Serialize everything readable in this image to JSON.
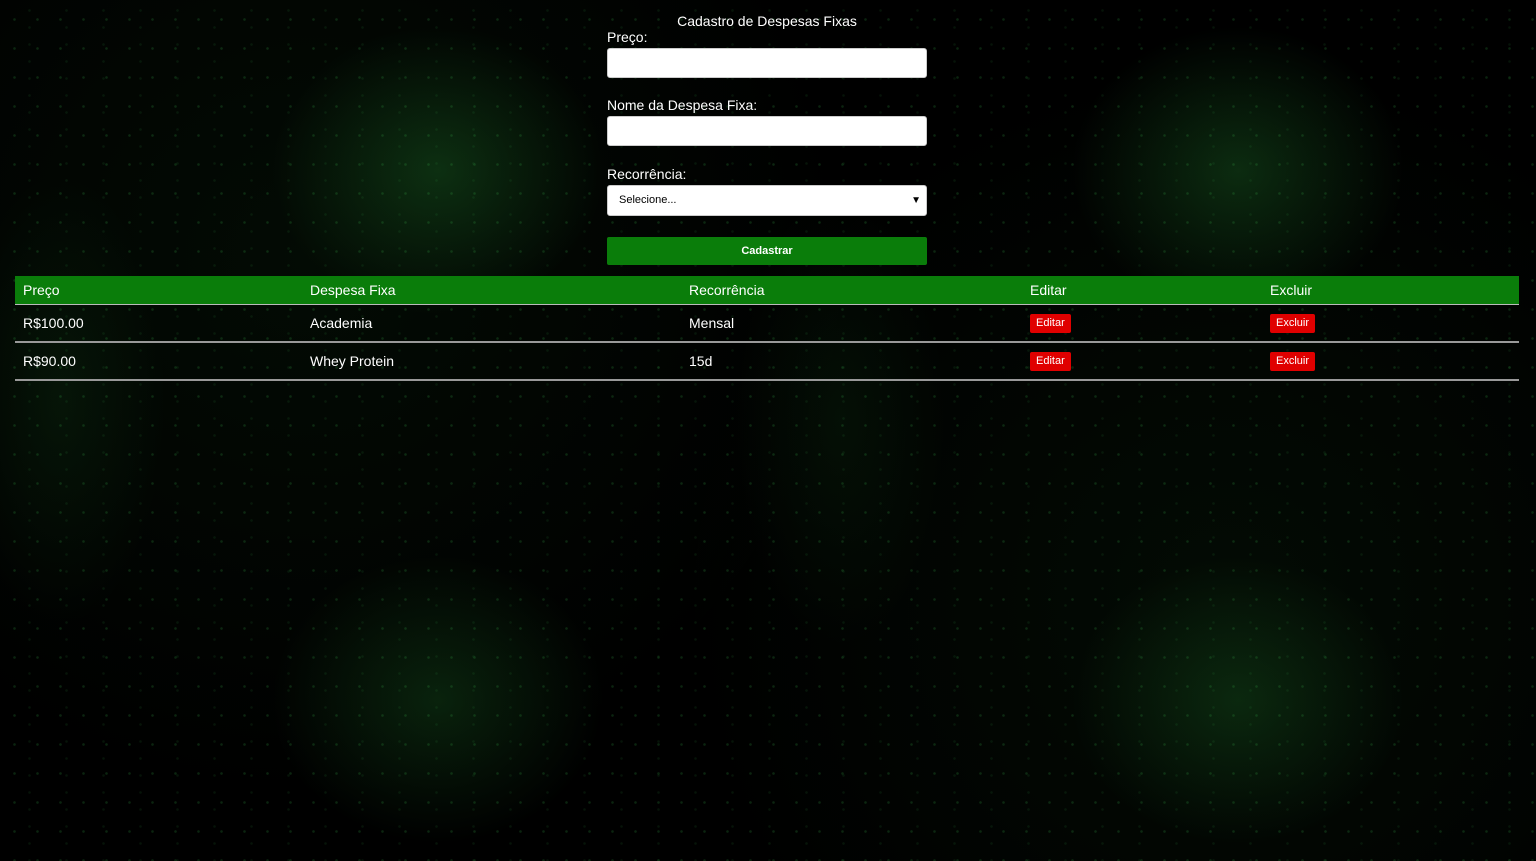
{
  "form": {
    "title": "Cadastro de Despesas Fixas",
    "price_label": "Preço:",
    "price_value": "",
    "name_label": "Nome da Despesa Fixa:",
    "name_value": "",
    "recurrence_label": "Recorrência:",
    "recurrence_selected": "Selecione...",
    "submit_label": "Cadastrar"
  },
  "table": {
    "headers": [
      "Preço",
      "Despesa Fixa",
      "Recorrência",
      "Editar",
      "Excluir"
    ],
    "rows": [
      {
        "price": "R$100.00",
        "name": "Academia",
        "recurrence": "Mensal",
        "edit_label": "Editar",
        "delete_label": "Excluir"
      },
      {
        "price": "R$90.00",
        "name": "Whey Protein",
        "recurrence": "15d",
        "edit_label": "Editar",
        "delete_label": "Excluir"
      }
    ]
  },
  "colors": {
    "background": "#000000",
    "accent_green": "#0a7d0a",
    "danger_red": "#e00000",
    "text": "#ffffff"
  },
  "icons": {
    "select_chevron": "chevron-down-icon"
  }
}
